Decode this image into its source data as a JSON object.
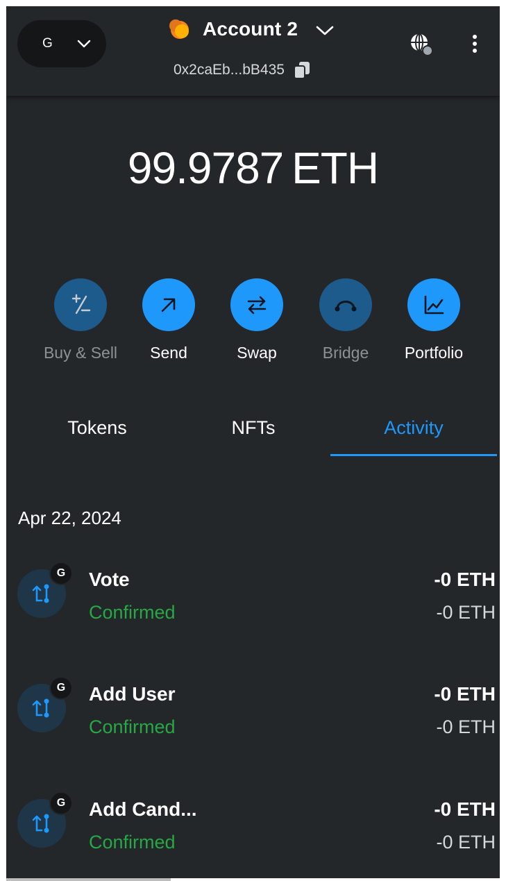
{
  "header": {
    "network_letter": "G",
    "account_name": "Account 2",
    "address": "0x2caEb...bB435"
  },
  "balance": {
    "amount": "99.9787",
    "unit": "ETH"
  },
  "actions": [
    {
      "label": "Buy & Sell",
      "icon": "plus-minus-icon",
      "state": "disabled"
    },
    {
      "label": "Send",
      "icon": "arrow-up-right-icon",
      "state": "active"
    },
    {
      "label": "Swap",
      "icon": "swap-arrows-icon",
      "state": "active"
    },
    {
      "label": "Bridge",
      "icon": "bridge-icon",
      "state": "disabled"
    },
    {
      "label": "Portfolio",
      "icon": "chart-icon",
      "state": "active"
    }
  ],
  "tabs": {
    "tokens": "Tokens",
    "nfts": "NFTs",
    "activity": "Activity",
    "selected": "activity"
  },
  "activity": {
    "date": "Apr 22, 2024",
    "items": [
      {
        "title": "Vote",
        "status": "Confirmed",
        "amount": "-0 ETH",
        "fiat": "-0 ETH",
        "badge": "G"
      },
      {
        "title": "Add User",
        "status": "Confirmed",
        "amount": "-0 ETH",
        "fiat": "-0 ETH",
        "badge": "G"
      },
      {
        "title": "Add Cand...",
        "status": "Confirmed",
        "amount": "-0 ETH",
        "fiat": "-0 ETH",
        "badge": "G"
      }
    ]
  },
  "colors": {
    "background": "#24272a",
    "accent": "#1f98fc",
    "accent_disabled": "#1c5b8c",
    "success": "#28a745",
    "network_pill": "#141618"
  }
}
